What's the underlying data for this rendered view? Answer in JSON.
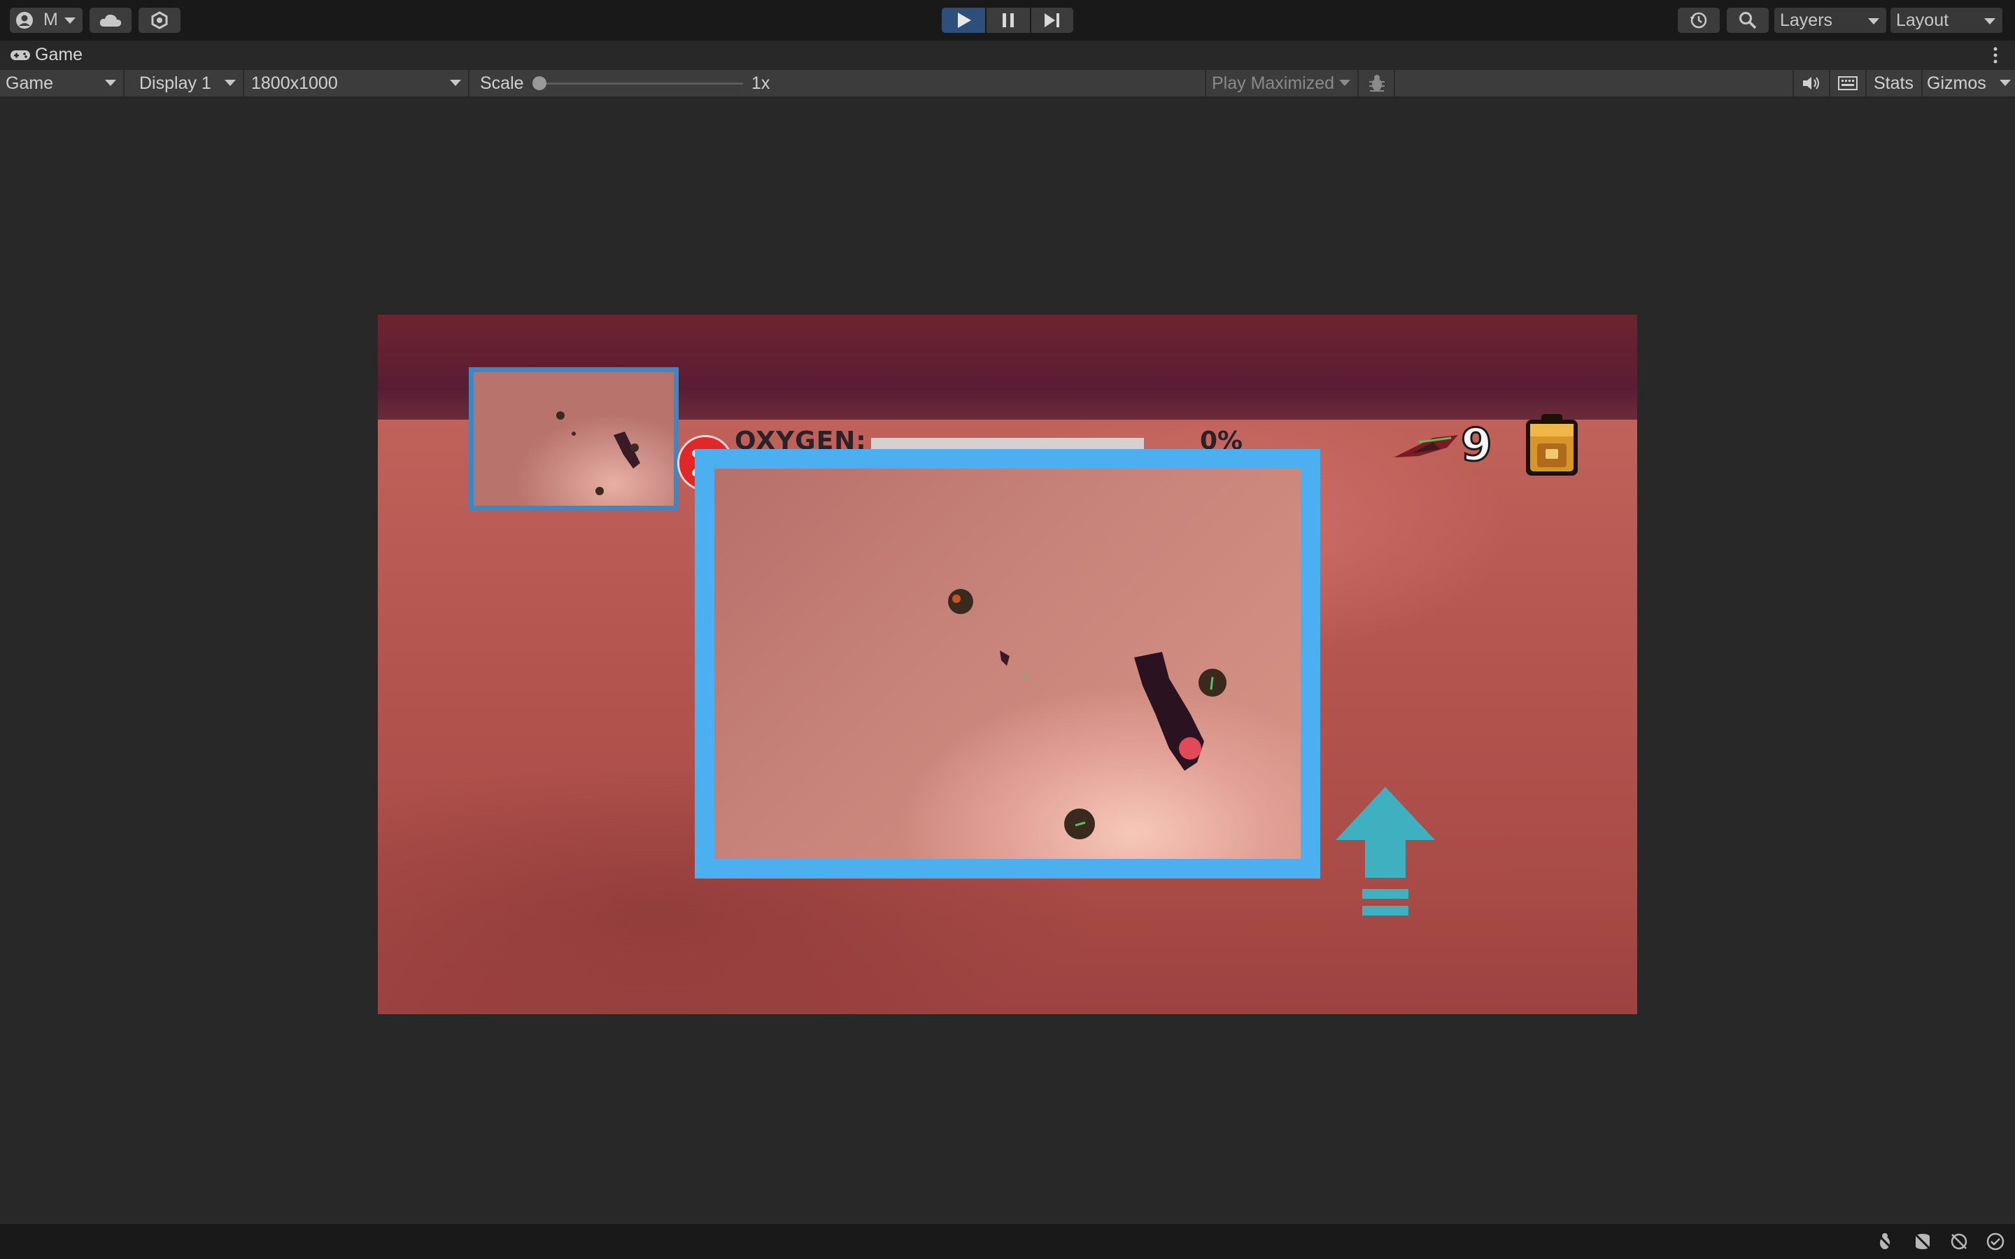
{
  "toolbar": {
    "account_label": "M",
    "layers_label": "Layers",
    "layout_label": "Layout"
  },
  "tab": {
    "title": "Game"
  },
  "game_view": {
    "mode": "Game",
    "display": "Display 1",
    "resolution": "1800x1000",
    "scale_label": "Scale",
    "scale_value": "1x",
    "play_mode": "Play Maximized",
    "stats_label": "Stats",
    "gizmos_label": "Gizmos"
  },
  "hud": {
    "oxygen_label": "OXYGEN:",
    "oxygen_percent_text": "0%",
    "oxygen_level": 0,
    "ship_count": "9"
  },
  "colors": {
    "play_active": "#2e4f7c",
    "map_border": "#4cb0f0",
    "close_red": "#e02828",
    "arrow_teal": "#3fb0c0"
  },
  "icons": [
    "account-icon",
    "cloud-icon",
    "services-icon",
    "play-icon",
    "pause-icon",
    "step-icon",
    "history-icon",
    "search-icon",
    "gamepad-icon",
    "more-icon",
    "bug-icon",
    "audio-icon",
    "keyboard-icon",
    "backpack-icon",
    "upgrade-arrow-icon"
  ]
}
